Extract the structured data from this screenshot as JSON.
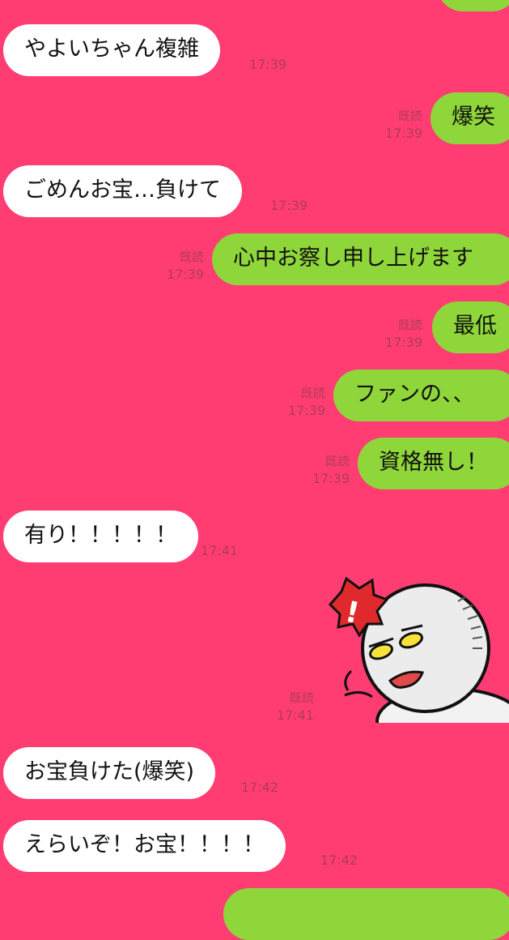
{
  "messages": [
    {
      "side": "in",
      "text": "やよいちゃん複雑",
      "time": "17:39"
    },
    {
      "side": "out",
      "text": "爆笑",
      "read": "既読",
      "time": "17:39"
    },
    {
      "side": "in",
      "text": "ごめんお宝…負けて",
      "time": "17:39"
    },
    {
      "side": "out",
      "text": "心中お察し申し上げます",
      "read": "既読",
      "time": "17:39"
    },
    {
      "side": "out",
      "text": "最低",
      "read": "既読",
      "time": "17:39"
    },
    {
      "side": "out",
      "text": "ファンの、、",
      "read": "既読",
      "time": "17:39"
    },
    {
      "side": "out",
      "text": "資格無し！",
      "read": "既読",
      "time": "17:39"
    },
    {
      "side": "in",
      "text": "有り！！！！！",
      "time": "17:41"
    },
    {
      "side": "out",
      "sticker": "angry-ghost-sticker",
      "read": "既読",
      "time": "17:41"
    },
    {
      "side": "in",
      "text": "お宝負けた(爆笑)",
      "time": "17:42"
    },
    {
      "side": "in",
      "text": "えらいぞ！お宝！！！！",
      "time": "17:42"
    }
  ]
}
